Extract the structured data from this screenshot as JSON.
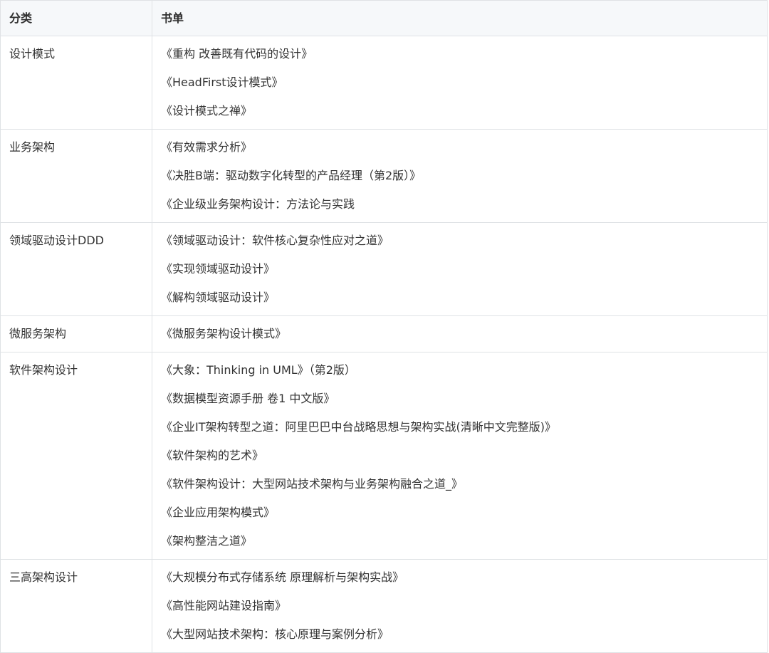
{
  "table": {
    "header": {
      "category": "分类",
      "books": "书单"
    },
    "rows": [
      {
        "category": "设计模式",
        "books": [
          "《重构 改善既有代码的设计》",
          "《HeadFirst设计模式》",
          "《设计模式之禅》"
        ]
      },
      {
        "category": "业务架构",
        "books": [
          "《有效需求分析》",
          "《决胜B端：驱动数字化转型的产品经理（第2版）》",
          "《企业级业务架构设计：方法论与实践"
        ]
      },
      {
        "category": "领域驱动设计DDD",
        "books": [
          "《领域驱动设计：软件核心复杂性应对之道》",
          "《实现领域驱动设计》",
          "《解构领域驱动设计》"
        ]
      },
      {
        "category": "微服务架构",
        "books": [
          "《微服务架构设计模式》"
        ]
      },
      {
        "category": "软件架构设计",
        "books": [
          "《大象：Thinking in UML》（第2版）",
          "《数据模型资源手册 卷1 中文版》",
          "《企业IT架构转型之道：阿里巴巴中台战略思想与架构实战(清晰中文完整版)》",
          "《软件架构的艺术》",
          "《软件架构设计：大型网站技术架构与业务架构融合之道_》",
          "《企业应用架构模式》",
          "《架构整洁之道》"
        ]
      },
      {
        "category": "三高架构设计",
        "books": [
          "《大规模分布式存储系统 原理解析与架构实战》",
          "《高性能网站建设指南》",
          "《大型网站技术架构：核心原理与案例分析》"
        ]
      }
    ]
  }
}
